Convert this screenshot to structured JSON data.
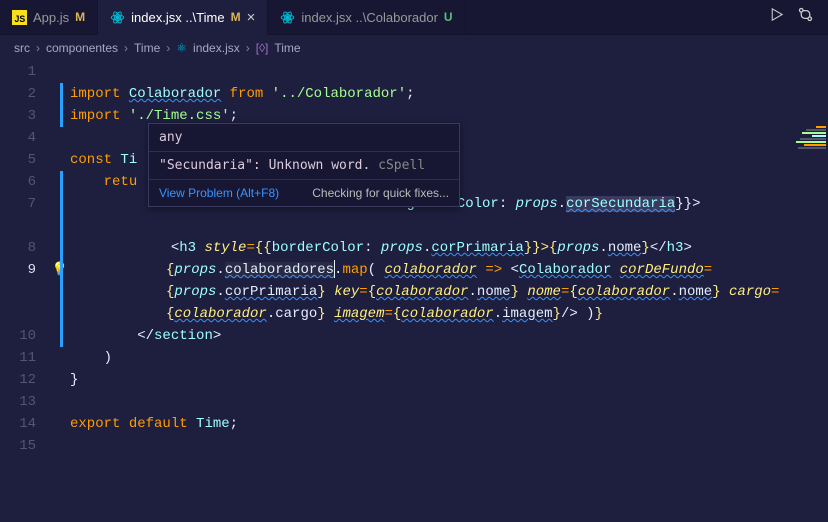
{
  "tabs": [
    {
      "icon": "js",
      "label": "App.js",
      "status": "M",
      "statusClass": "m",
      "active": false
    },
    {
      "icon": "react",
      "label": "index.jsx ..\\Time",
      "status": "M",
      "statusClass": "m",
      "active": true,
      "close": "×"
    },
    {
      "icon": "react",
      "label": "index.jsx ..\\Colaborador",
      "status": "U",
      "statusClass": "u",
      "active": false
    }
  ],
  "breadcrumb": {
    "seg0": "src",
    "seg1": "componentes",
    "seg2": "Time",
    "seg3": "index.jsx",
    "seg4": "Time",
    "sep": "›"
  },
  "hover": {
    "type": "any",
    "msg_pre": "\"Secundaria\"",
    "msg_mid": ": Unknown word.",
    "msg_src": "cSpell",
    "view": "View Problem (Alt+F8)",
    "quick": "Checking for quick fixes..."
  },
  "lines": {
    "l1": "",
    "l2_import": "import",
    "l2_cls": "Colaborador",
    "l2_from": "from",
    "l2_str": "'../Colaborador'",
    "l2_semi": ";",
    "l3_import": "import",
    "l3_str": "'./Time.css'",
    "l3_semi": ";",
    "l5_const": "const",
    "l5_name": "Ti",
    "l6_return": "retu",
    "l7_tail_bgc": "kgroundColor",
    "l7_tail_props": "props",
    "l7_tail_dot": ".",
    "l7w_cor": "corSecundaria",
    "l7w_close": "}}>",
    "l8_open": "<",
    "l8_tag": "h3",
    "l8_attr": "style",
    "l8_eq": "=",
    "l8_bb": "{{",
    "l8_bc": "borderColor",
    "l8_props": "props",
    "l8_cp": "corPrimaria",
    "l8_ee": "}}>",
    "l8_jxo": "{",
    "l8_pn": "props",
    "l8_nm": "nome",
    "l8_jxc": "}",
    "l8_c1": "</",
    "l8_c2": ">",
    "l9_jxo": "{",
    "l9_props": "props",
    "l9_colab": "colaboradores",
    "l9_map": "map",
    "l9_par": "colaborador",
    "l9_arrow": "=>",
    "l9_comp": "Colaborador",
    "l9_a_cdf": "corDeFundo",
    "l9_a_cp": "corPrimaria",
    "l9_a_key": "key",
    "l9_a_nome": "nome",
    "l9_a_cargo": "cargo",
    "l9_a_img": "imagem",
    "l9_m_nome": "nome",
    "l9_m_cargo": "cargo",
    "l9_m_img": "imagem",
    "l9_selfclose": "/>",
    "l9_endparen": ")",
    "l9_jxc": "}",
    "l10_open": "</",
    "l10_tag": "section",
    "l10_close": ">",
    "l11": ")",
    "l12": "}",
    "l14_export": "export",
    "l14_default": "default",
    "l14_name": "Time",
    "l14_semi": ";"
  },
  "gutter": [
    "1",
    "2",
    "3",
    "4",
    "5",
    "6",
    "7",
    "8",
    "9",
    "10",
    "11",
    "12",
    "13",
    "14",
    "15"
  ]
}
